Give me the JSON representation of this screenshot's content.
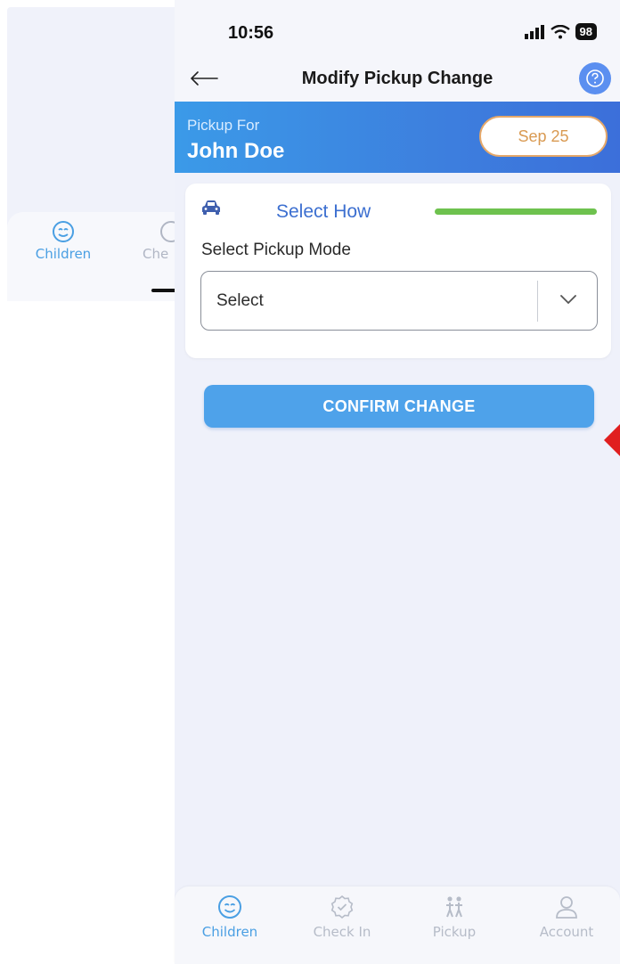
{
  "background_screen": {
    "tabs": [
      {
        "label": "Children",
        "icon": "smiley-icon"
      },
      {
        "label": "Che",
        "icon": "check-badge-icon"
      }
    ]
  },
  "status_bar": {
    "time": "10:56",
    "battery": "98"
  },
  "nav": {
    "title": "Modify Pickup Change",
    "back_icon": "arrow-left-icon",
    "help_icon": "question-icon"
  },
  "banner": {
    "pickup_for_label": "Pickup For",
    "child_name": "John Doe",
    "date": "Sep 25"
  },
  "card": {
    "step_label": "Select How",
    "field_label": "Select Pickup Mode",
    "select_value": "Select"
  },
  "actions": {
    "confirm_label": "CONFIRM CHANGE"
  },
  "tabbar": {
    "tabs": [
      {
        "label": "Children",
        "icon": "smiley-icon",
        "active": true
      },
      {
        "label": "Check In",
        "icon": "check-badge-icon",
        "active": false
      },
      {
        "label": "Pickup",
        "icon": "people-walking-icon",
        "active": false
      },
      {
        "label": "Account",
        "icon": "person-icon",
        "active": false
      }
    ]
  },
  "colors": {
    "accent": "#4ea2ea",
    "banner": "#3d7fde",
    "progress": "#6ec24e",
    "date_pill": "#e5a86a"
  }
}
